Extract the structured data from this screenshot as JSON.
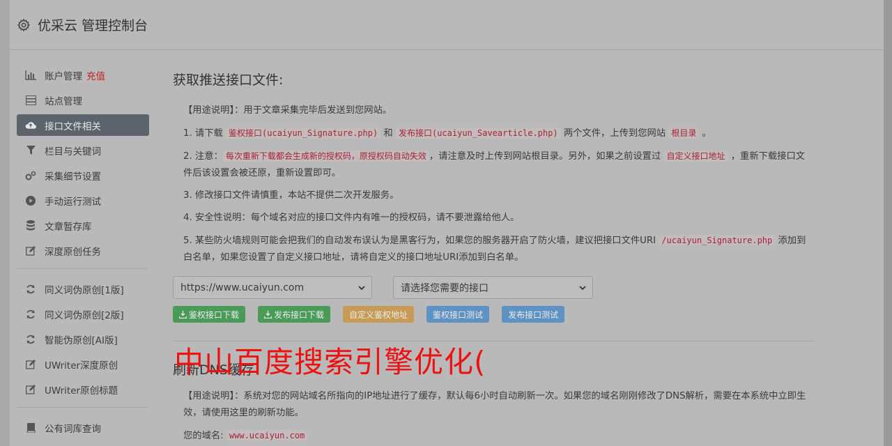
{
  "header": {
    "title": "优采云 管理控制台"
  },
  "sidebar": {
    "items": [
      {
        "label": "账户管理",
        "extra": "充值",
        "icon": "bar-chart-icon"
      },
      {
        "label": "站点管理",
        "icon": "server-icon"
      },
      {
        "label": "接口文件相关",
        "icon": "cloud-upload-icon",
        "active": true
      },
      {
        "label": "栏目与关键词",
        "icon": "filter-icon"
      },
      {
        "label": "采集细节设置",
        "icon": "gears-icon"
      },
      {
        "label": "手动运行测试",
        "icon": "play-circle-icon"
      },
      {
        "label": "文章暂存库",
        "icon": "database-icon"
      },
      {
        "label": "深度原创任务",
        "icon": "edit-icon"
      },
      {
        "label": "同义词伪原创[1版]",
        "icon": "refresh-icon"
      },
      {
        "label": "同义词伪原创[2版]",
        "icon": "refresh-icon"
      },
      {
        "label": "智能伪原创[AI版]",
        "icon": "refresh-icon"
      },
      {
        "label": "UWriter深度原创",
        "icon": "edit-icon"
      },
      {
        "label": "UWriter原创标题",
        "icon": "edit-icon"
      },
      {
        "label": "公有词库查询",
        "icon": "book-icon"
      }
    ]
  },
  "main": {
    "section1_title": "获取推送接口文件:",
    "usage": "【用途说明】：用于文章采集完毕后发送到您网站。",
    "p1": {
      "a": "1. 请下载 ",
      "code1": "鉴权接口(ucaiyun_Signature.php)",
      "b": " 和 ",
      "code2": "发布接口(ucaiyun_Savearticle.php)",
      "c": " 两个文件，上传到您网站 ",
      "code3": "根目录",
      "d": " 。"
    },
    "p2": {
      "a": "2. 注意：",
      "code1": "每次重新下载都会生成新的授权码，原授权码自动失效",
      "b": "，请注意及时上传到网站根目录。另外，如果之前设置过 ",
      "code2": "自定义接口地址",
      "c": " ，重新下载接口文件后该设置会被还原，重新设置即可。"
    },
    "p3": "3. 修改接口文件请慎重，本站不提供二次开发服务。",
    "p4": "4. 安全性说明：每个域名对应的接口文件内有唯一的授权码，请不要泄露给他人。",
    "p5": {
      "a": "5. 某些防火墙规则可能会把我们的自动发布误认为是黑客行为，如果您的服务器开启了防火墙，建议把接口文件URI ",
      "code1": "/ucaiyun_Signature.php",
      "b": " 添加到白名单，如果您设置了自定义接口地址，请将自定义的接口地址URI添加到白名单。"
    },
    "select_site": "https://www.ucaiyun.com",
    "select_api": "请选择您需要的接口",
    "btn_sig_download": "鉴权接口下载",
    "btn_pub_download": "发布接口下载",
    "btn_custom_sig": "自定义鉴权地址",
    "btn_sig_test": "鉴权接口测试",
    "btn_pub_test": "发布接口测试",
    "section2_title": "刷新DNS缓存",
    "dns_usage": "【用途说明】：系统对您的网站域名所指向的IP地址进行了缓存，默认每6小时自动刷新一次。如果您的域名刚刚修改了DNS解析，需要在本系统中立即生效，请使用这里的刷新功能。",
    "domain_label": "您的域名:",
    "domain_value": "www.ucaiyun.com"
  },
  "overlay_text": "中山百度搜索引擎优化("
}
